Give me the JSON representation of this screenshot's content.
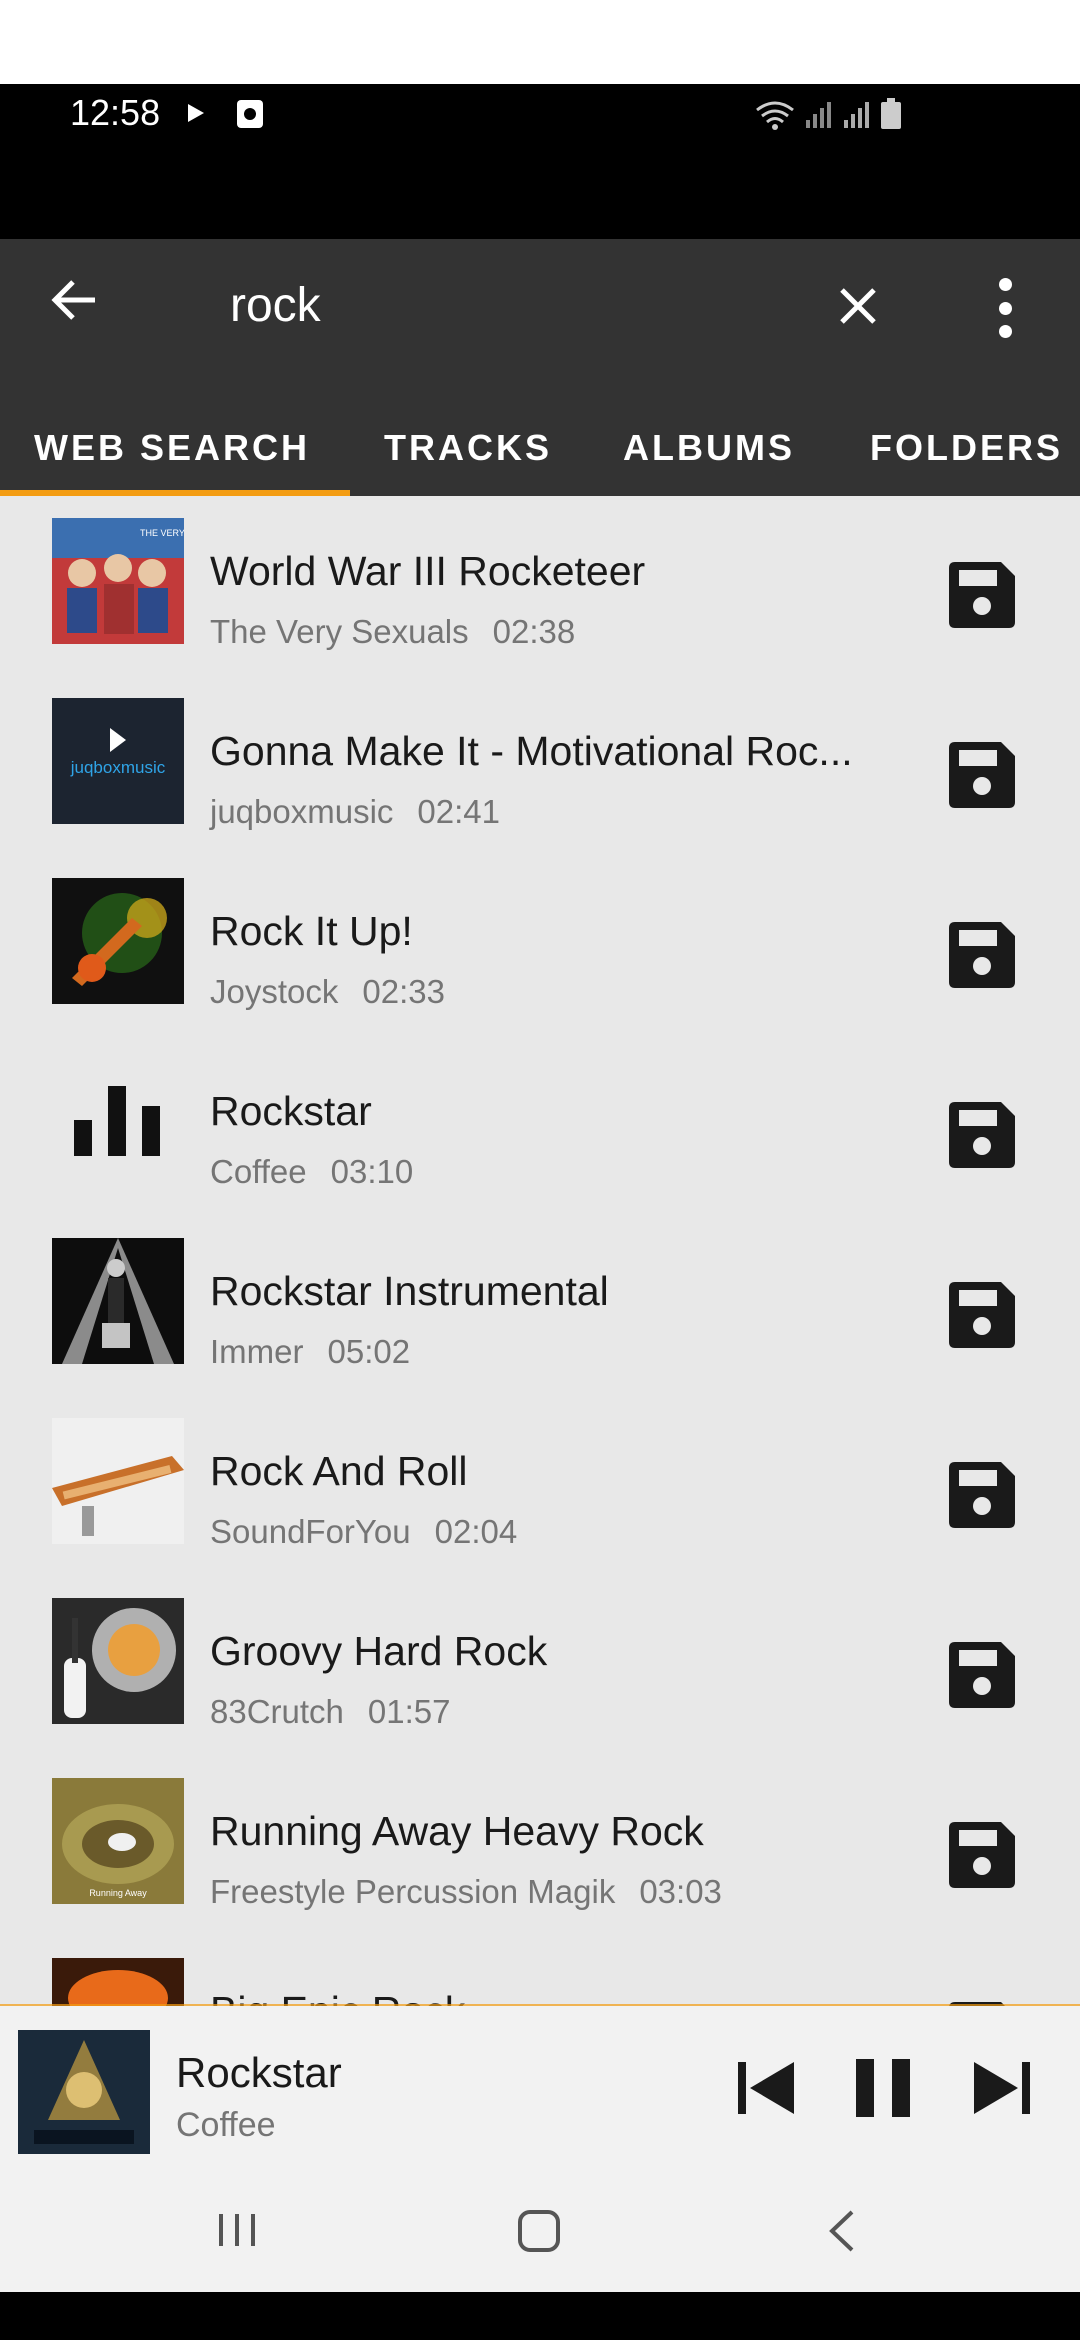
{
  "status_bar": {
    "time": "12:58",
    "icons": [
      "play-indicator-icon",
      "media-icon",
      "wifi-icon",
      "signal-icon",
      "signal-icon",
      "battery-icon"
    ]
  },
  "search": {
    "query": "rock",
    "back_icon": "arrow-left-icon",
    "clear_icon": "close-icon",
    "more_icon": "more-vert-icon"
  },
  "tabs": [
    {
      "label": "WEB SEARCH",
      "selected": true
    },
    {
      "label": "TRACKS",
      "selected": false
    },
    {
      "label": "ALBUMS",
      "selected": false
    },
    {
      "label": "FOLDERS",
      "selected": false
    }
  ],
  "accent_color": "#f39c12",
  "tracks": [
    {
      "title": "World War III Rocketeer",
      "artist": "The Very Sexuals",
      "duration": "02:38",
      "thumb_label": "THE VERY SEXUALS"
    },
    {
      "title": "Gonna Make It - Motivational Roc...",
      "artist": "juqboxmusic",
      "duration": "02:41",
      "thumb_label": "juqboxmusic"
    },
    {
      "title": "Rock It Up!",
      "artist": "Joystock",
      "duration": "02:33",
      "thumb_label": ""
    },
    {
      "title": "Rockstar",
      "artist": "Coffee",
      "duration": "03:10",
      "thumb_label": ""
    },
    {
      "title": "Rockstar  Instrumental",
      "artist": "Immer",
      "duration": "05:02",
      "thumb_label": ""
    },
    {
      "title": "Rock And Roll",
      "artist": "SoundForYou",
      "duration": "02:04",
      "thumb_label": ""
    },
    {
      "title": "Groovy Hard Rock",
      "artist": "83Crutch",
      "duration": "01:57",
      "thumb_label": ""
    },
    {
      "title": "Running Away  Heavy Rock",
      "artist": "Freestyle Percussion Magik",
      "duration": "03:03",
      "thumb_label": "Running Away"
    },
    {
      "title": "Big Epic Rock",
      "artist": "",
      "duration": "",
      "thumb_label": ""
    }
  ],
  "now_playing": {
    "title": "Rockstar",
    "artist": "Coffee",
    "state": "playing"
  },
  "nav_bar": [
    "recents-icon",
    "home-icon",
    "back-icon"
  ]
}
